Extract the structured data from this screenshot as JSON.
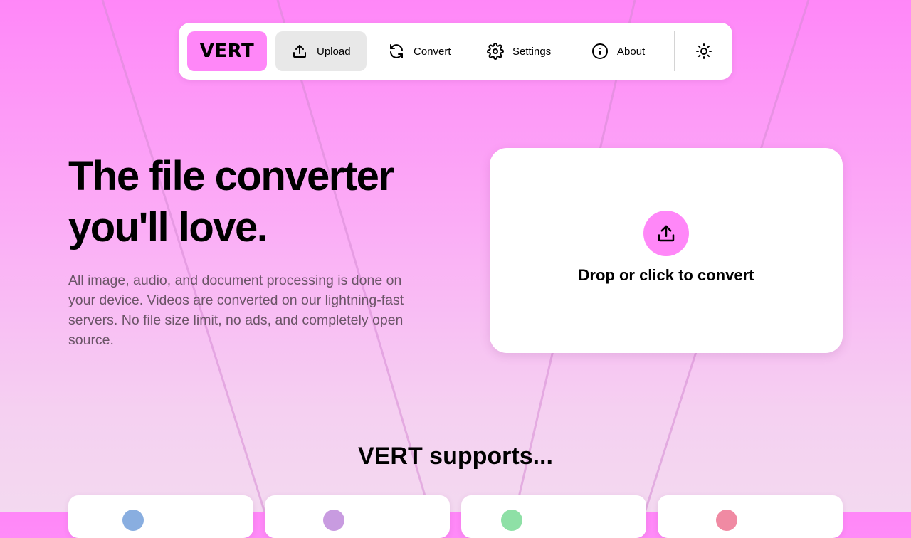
{
  "nav": {
    "logo": "VERT",
    "items": [
      {
        "label": "Upload",
        "icon": "upload-icon",
        "active": true
      },
      {
        "label": "Convert",
        "icon": "refresh-icon",
        "active": false
      },
      {
        "label": "Settings",
        "icon": "gear-icon",
        "active": false
      },
      {
        "label": "About",
        "icon": "info-icon",
        "active": false
      }
    ],
    "theme_toggle_icon": "sun-icon"
  },
  "hero": {
    "title_line1": "The file converter",
    "title_line2": "you'll love.",
    "description": "All image, audio, and document processing is done on your device. Videos are converted on our lightning-fast servers. No file size limit, no ads, and completely open source."
  },
  "dropzone": {
    "icon": "upload-icon",
    "label": "Drop or click to convert"
  },
  "supports": {
    "title": "VERT supports...",
    "card_colors": [
      "#89aee0",
      "#c89be0",
      "#8ee0a6",
      "#f08aa3"
    ]
  },
  "colors": {
    "accent": "#ff87f8",
    "description_text": "#6b5467"
  }
}
